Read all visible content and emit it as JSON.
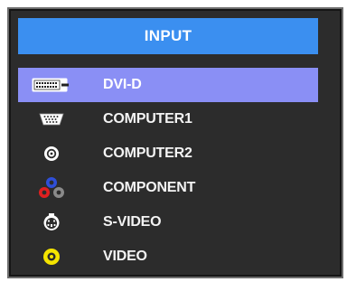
{
  "menu": {
    "title": "INPUT",
    "items": [
      {
        "label": "DVI-D",
        "icon": "dvi-connector-icon",
        "selected": true
      },
      {
        "label": "COMPUTER1",
        "icon": "vga-connector-icon",
        "selected": false
      },
      {
        "label": "COMPUTER2",
        "icon": "bnc-connector-icon",
        "selected": false
      },
      {
        "label": "COMPONENT",
        "icon": "component-rca-icon",
        "selected": false
      },
      {
        "label": "S-VIDEO",
        "icon": "s-video-connector-icon",
        "selected": false
      },
      {
        "label": "VIDEO",
        "icon": "composite-video-icon",
        "selected": false
      }
    ]
  },
  "colors": {
    "panel_background": "#2c2c2c",
    "title_bar": "#3b8ff0",
    "selection_highlight": "#8a8ff5",
    "text": "#ffffff",
    "component_red": "#e02020",
    "component_green": "#777777",
    "component_blue": "#2f4fd8",
    "video_yellow": "#f5e400"
  }
}
